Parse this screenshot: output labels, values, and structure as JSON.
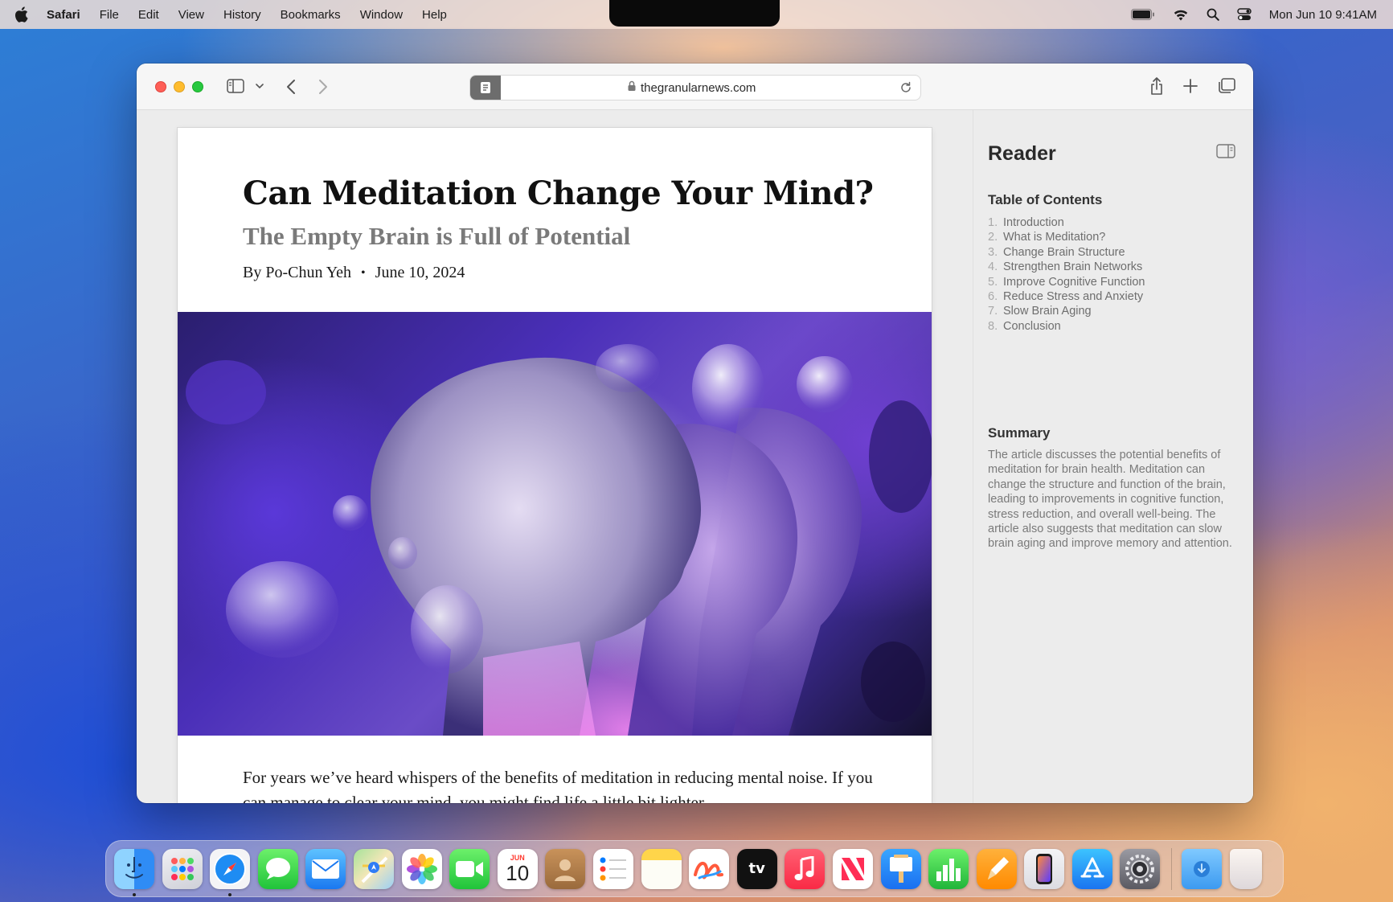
{
  "menubar": {
    "app_name": "Safari",
    "items": [
      "File",
      "Edit",
      "View",
      "History",
      "Bookmarks",
      "Window",
      "Help"
    ],
    "clock": "Mon Jun 10  9:41AM",
    "status_icons": [
      "battery-icon",
      "wifi-icon",
      "search-icon",
      "control-center-icon"
    ]
  },
  "browser": {
    "url": "thegranularnews.com",
    "toolbar_icons": [
      "sidebar-icon",
      "chevron-down-icon",
      "back-icon",
      "forward-icon",
      "reader-icon",
      "lock-icon",
      "reload-icon",
      "share-icon",
      "new-tab-icon",
      "tab-overview-icon"
    ]
  },
  "article": {
    "title": "Can Meditation Change Your Mind?",
    "subtitle": "The Empty Brain is Full of Potential",
    "author": "By Po-Chun Yeh",
    "separator": "•",
    "date": "June 10, 2024",
    "body": "For years we’ve heard whispers of the benefits of meditation in reducing mental noise. If you can manage to clear your mind, you might find life a little bit lighter."
  },
  "reader": {
    "title": "Reader",
    "toc_heading": "Table of Contents",
    "toc": [
      {
        "num": "1.",
        "label": "Introduction"
      },
      {
        "num": "2.",
        "label": "What is Meditation?"
      },
      {
        "num": "3.",
        "label": "Change Brain Structure"
      },
      {
        "num": "4.",
        "label": "Strengthen Brain Networks"
      },
      {
        "num": "5.",
        "label": "Improve Cognitive Function"
      },
      {
        "num": "6.",
        "label": "Reduce Stress and Anxiety"
      },
      {
        "num": "7.",
        "label": "Slow Brain Aging"
      },
      {
        "num": "8.",
        "label": "Conclusion"
      }
    ],
    "summary_heading": "Summary",
    "summary": "The article discusses the potential benefits of meditation for brain health. Meditation can change the structure and function of the brain, leading to improvements in cognitive function, stress reduction, and overall well-being. The article also suggests that meditation can slow brain aging and improve memory and attention."
  },
  "dock": {
    "calendar_month": "JUN",
    "calendar_day": "10",
    "tv_label": "tv",
    "apps": [
      "Finder",
      "Launchpad",
      "Safari",
      "Messages",
      "Mail",
      "Maps",
      "Photos",
      "FaceTime",
      "Calendar",
      "Contacts",
      "Reminders",
      "Notes",
      "Freeform",
      "TV",
      "Music",
      "News",
      "Keynote",
      "Numbers",
      "Pages",
      "iPhone Mirroring",
      "App Store",
      "System Settings",
      "Downloads",
      "Trash"
    ],
    "running": [
      "Finder",
      "Safari"
    ]
  }
}
